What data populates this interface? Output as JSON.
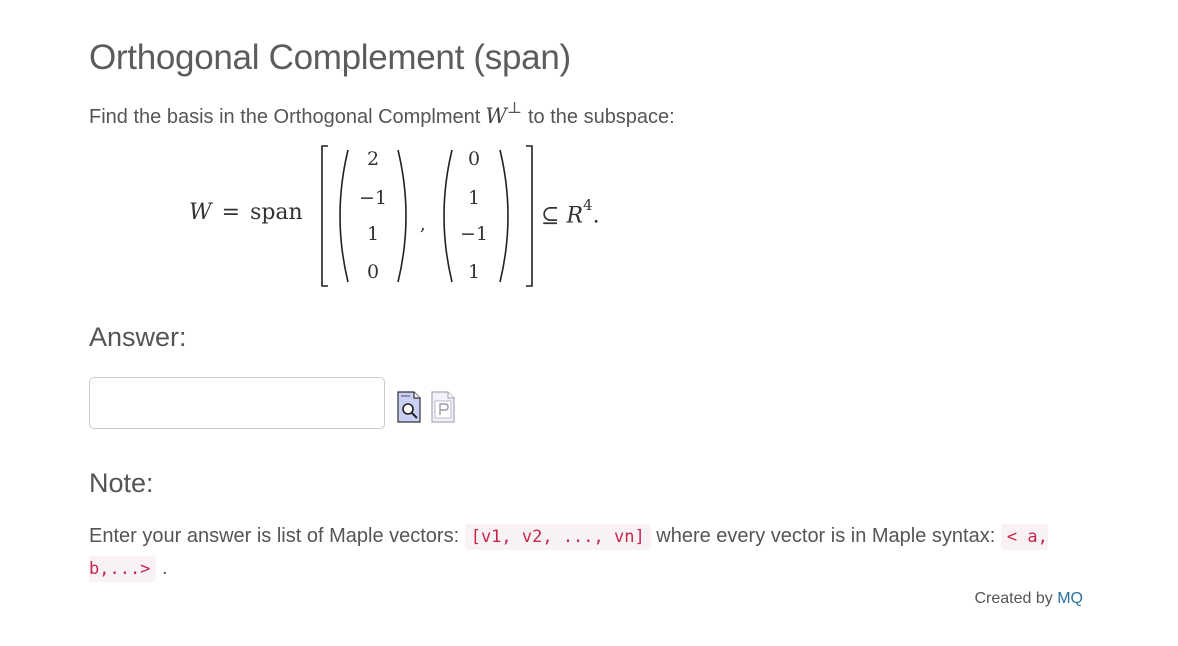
{
  "header": {
    "title": "Orthogonal Complement (span)"
  },
  "problem": {
    "prompt_before": "Find the basis in the Orthogonal Complment",
    "symbol": "W",
    "perp": "⊥",
    "prompt_after": "to the subspace:",
    "w_var": "W",
    "equals": "=",
    "span_word": "span",
    "vector1": [
      "2",
      "−1",
      "1",
      "0"
    ],
    "vector2": [
      "0",
      "1",
      "−1",
      "1"
    ],
    "comma": ",",
    "subset_symbol": "⊆",
    "space": "R",
    "space_dim": "4",
    "period": "."
  },
  "answer": {
    "heading": "Answer:",
    "input_value": "",
    "input_placeholder": "",
    "icons": [
      "preview-icon",
      "paste-icon"
    ]
  },
  "note": {
    "heading": "Note:",
    "text_before": "Enter your answer is list of Maple vectors:",
    "code_list": "[v1, v2, ..., vn]",
    "text_middle": "where every vector is in Maple syntax:",
    "code_vector": "< a, b,...>",
    "text_after": "."
  },
  "footer": {
    "credit_text": "Created by",
    "credit_link": "MQ",
    "link_color": "#2a6fa0"
  }
}
